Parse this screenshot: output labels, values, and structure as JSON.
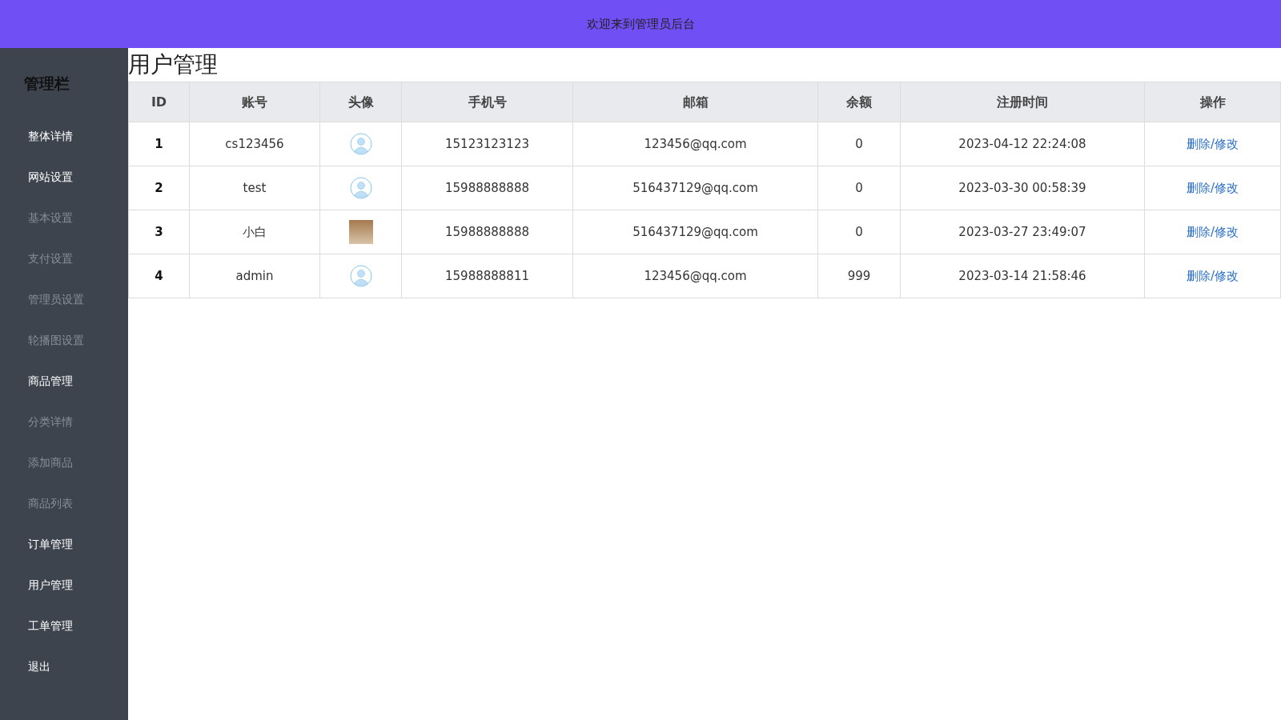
{
  "header": {
    "title": "欢迎来到管理员后台"
  },
  "sidebar": {
    "title": "管理栏",
    "items": [
      {
        "label": "整体详情",
        "kind": "group"
      },
      {
        "label": "网站设置",
        "kind": "group"
      },
      {
        "label": "基本设置",
        "kind": "sub"
      },
      {
        "label": "支付设置",
        "kind": "sub"
      },
      {
        "label": "管理员设置",
        "kind": "sub"
      },
      {
        "label": "轮播图设置",
        "kind": "sub"
      },
      {
        "label": "商品管理",
        "kind": "group"
      },
      {
        "label": "分类详情",
        "kind": "sub"
      },
      {
        "label": "添加商品",
        "kind": "sub"
      },
      {
        "label": "商品列表",
        "kind": "sub"
      },
      {
        "label": "订单管理",
        "kind": "group"
      },
      {
        "label": "用户管理",
        "kind": "group"
      },
      {
        "label": "工单管理",
        "kind": "group"
      },
      {
        "label": "退出",
        "kind": "group"
      }
    ]
  },
  "page": {
    "title": "用户管理"
  },
  "table": {
    "columns": [
      "ID",
      "账号",
      "头像",
      "手机号",
      "邮箱",
      "余额",
      "注册时间",
      "操作"
    ],
    "rows": [
      {
        "id": "1",
        "account": "cs123456",
        "avatar": {
          "kind": "default"
        },
        "phone": "15123123123",
        "email": "123456@qq.com",
        "balance": "0",
        "registered": "2023-04-12 22:24:08",
        "actions": [
          "删除",
          "修改"
        ],
        "separator": "/"
      },
      {
        "id": "2",
        "account": "test",
        "avatar": {
          "kind": "default"
        },
        "phone": "15988888888",
        "email": "516437129@qq.com",
        "balance": "0",
        "registered": "2023-03-30 00:58:39",
        "actions": [
          "删除",
          "修改"
        ],
        "separator": "/"
      },
      {
        "id": "3",
        "account": "小白",
        "avatar": {
          "kind": "photo"
        },
        "phone": "15988888888",
        "email": "516437129@qq.com",
        "balance": "0",
        "registered": "2023-03-27 23:49:07",
        "actions": [
          "删除",
          "修改"
        ],
        "separator": "/"
      },
      {
        "id": "4",
        "account": "admin",
        "avatar": {
          "kind": "default"
        },
        "phone": "15988888811",
        "email": "123456@qq.com",
        "balance": "999",
        "registered": "2023-03-14 21:58:46",
        "actions": [
          "删除",
          "修改"
        ],
        "separator": "/"
      }
    ]
  }
}
